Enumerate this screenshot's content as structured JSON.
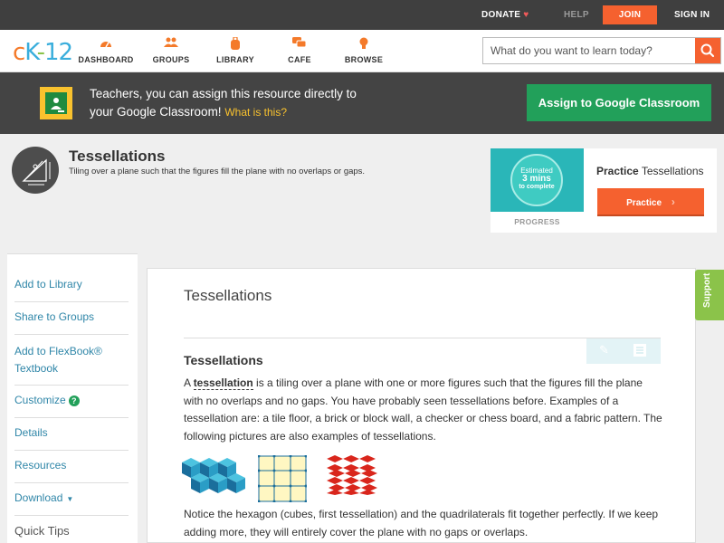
{
  "topbar": {
    "donate": "DONATE",
    "help": "HELP",
    "join": "JOIN",
    "signin": "SIGN IN"
  },
  "logo": {
    "c": "c",
    "k": "K",
    "dash": "-",
    "n": "12"
  },
  "nav": {
    "items": [
      {
        "label": "DASHBOARD",
        "icon": "speedometer-icon"
      },
      {
        "label": "GROUPS",
        "icon": "people-icon"
      },
      {
        "label": "LIBRARY",
        "icon": "backpack-icon"
      },
      {
        "label": "CAFE",
        "icon": "chat-icon"
      },
      {
        "label": "BROWSE",
        "icon": "lightbulb-icon"
      }
    ],
    "search_placeholder": "What do you want to learn today?"
  },
  "banner": {
    "line1": "Teachers, you can assign this resource directly to",
    "line2": "your Google Classroom!",
    "what": "What is this?",
    "assign_label": "Assign to Google Classroom"
  },
  "concept": {
    "title": "Tessellations",
    "description": "Tiling over a plane such that the figures fill the plane with no overlaps or gaps."
  },
  "practice": {
    "estimated": "Estimated",
    "mins": "3 mins",
    "to_complete": "to complete",
    "progress": "PROGRESS",
    "title_bold": "Practice",
    "title_rest": "Tessellations",
    "button": "Practice"
  },
  "sidebar": {
    "items": [
      "Add to Library",
      "Share to Groups",
      "Add to FlexBook® Textbook",
      "Customize",
      "Details",
      "Resources",
      "Download"
    ],
    "quick_tips": "Quick Tips"
  },
  "main": {
    "title": "Tessellations",
    "section_title": "Tessellations",
    "para1_a": "A ",
    "para1_term": "tessellation",
    "para1_b": " is a tiling over a plane with one or more figures such that the figures fill the plane with no overlaps and no gaps. You have probably seen tessellations before. Examples of a tessellation are: a tile floor, a brick or block wall, a checker or chess board, and a fabric pattern. The following pictures are also examples of tessellations.",
    "para2": "Notice the hexagon (cubes, first tessellation) and the quadrilaterals fit together perfectly. If we keep adding more, they will entirely cover the plane with no gaps or overlaps."
  },
  "support": "Support",
  "colors": {
    "accent_orange": "#f5612f",
    "google_green": "#22a05a",
    "link_blue": "#2f86a8",
    "support_green": "#8bc34a"
  }
}
